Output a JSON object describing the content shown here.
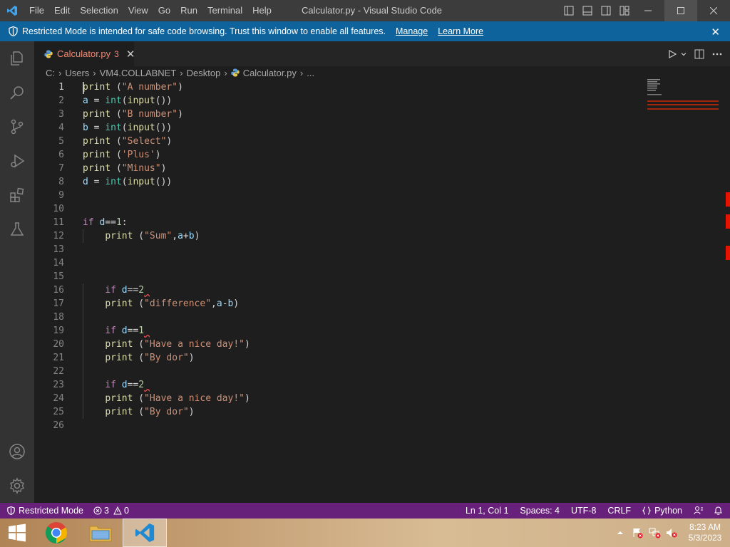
{
  "titlebar": {
    "menu": [
      "File",
      "Edit",
      "Selection",
      "View",
      "Go",
      "Run",
      "Terminal",
      "Help"
    ],
    "title": "Calculator.py - Visual Studio Code"
  },
  "banner": {
    "message": "Restricted Mode is intended for safe code browsing. Trust this window to enable all features.",
    "manage": "Manage",
    "learn_more": "Learn More"
  },
  "tab": {
    "name": "Calculator.py",
    "problems": "3"
  },
  "breadcrumbs": [
    "C:",
    "Users",
    "VM4.COLLABNET",
    "Desktop",
    "Calculator.py",
    "..."
  ],
  "editor": {
    "line_numbers": [
      "1",
      "2",
      "3",
      "4",
      "5",
      "6",
      "7",
      "8",
      "9",
      "10",
      "11",
      "12",
      "13",
      "14",
      "15",
      "16",
      "17",
      "18",
      "19",
      "20",
      "21",
      "22",
      "23",
      "24",
      "25",
      "26"
    ]
  },
  "statusbar": {
    "restricted_mode": "Restricted Mode",
    "errors": "3",
    "warnings": "0",
    "position": "Ln 1, Col 1",
    "spaces": "Spaces: 4",
    "encoding": "UTF-8",
    "eol": "CRLF",
    "language": "Python"
  },
  "taskbar": {
    "time": "8:23 AM",
    "date": "5/3/2023"
  },
  "colors": {
    "accent": "#0e639c",
    "statusbar": "#68217a",
    "error": "#f48771"
  }
}
